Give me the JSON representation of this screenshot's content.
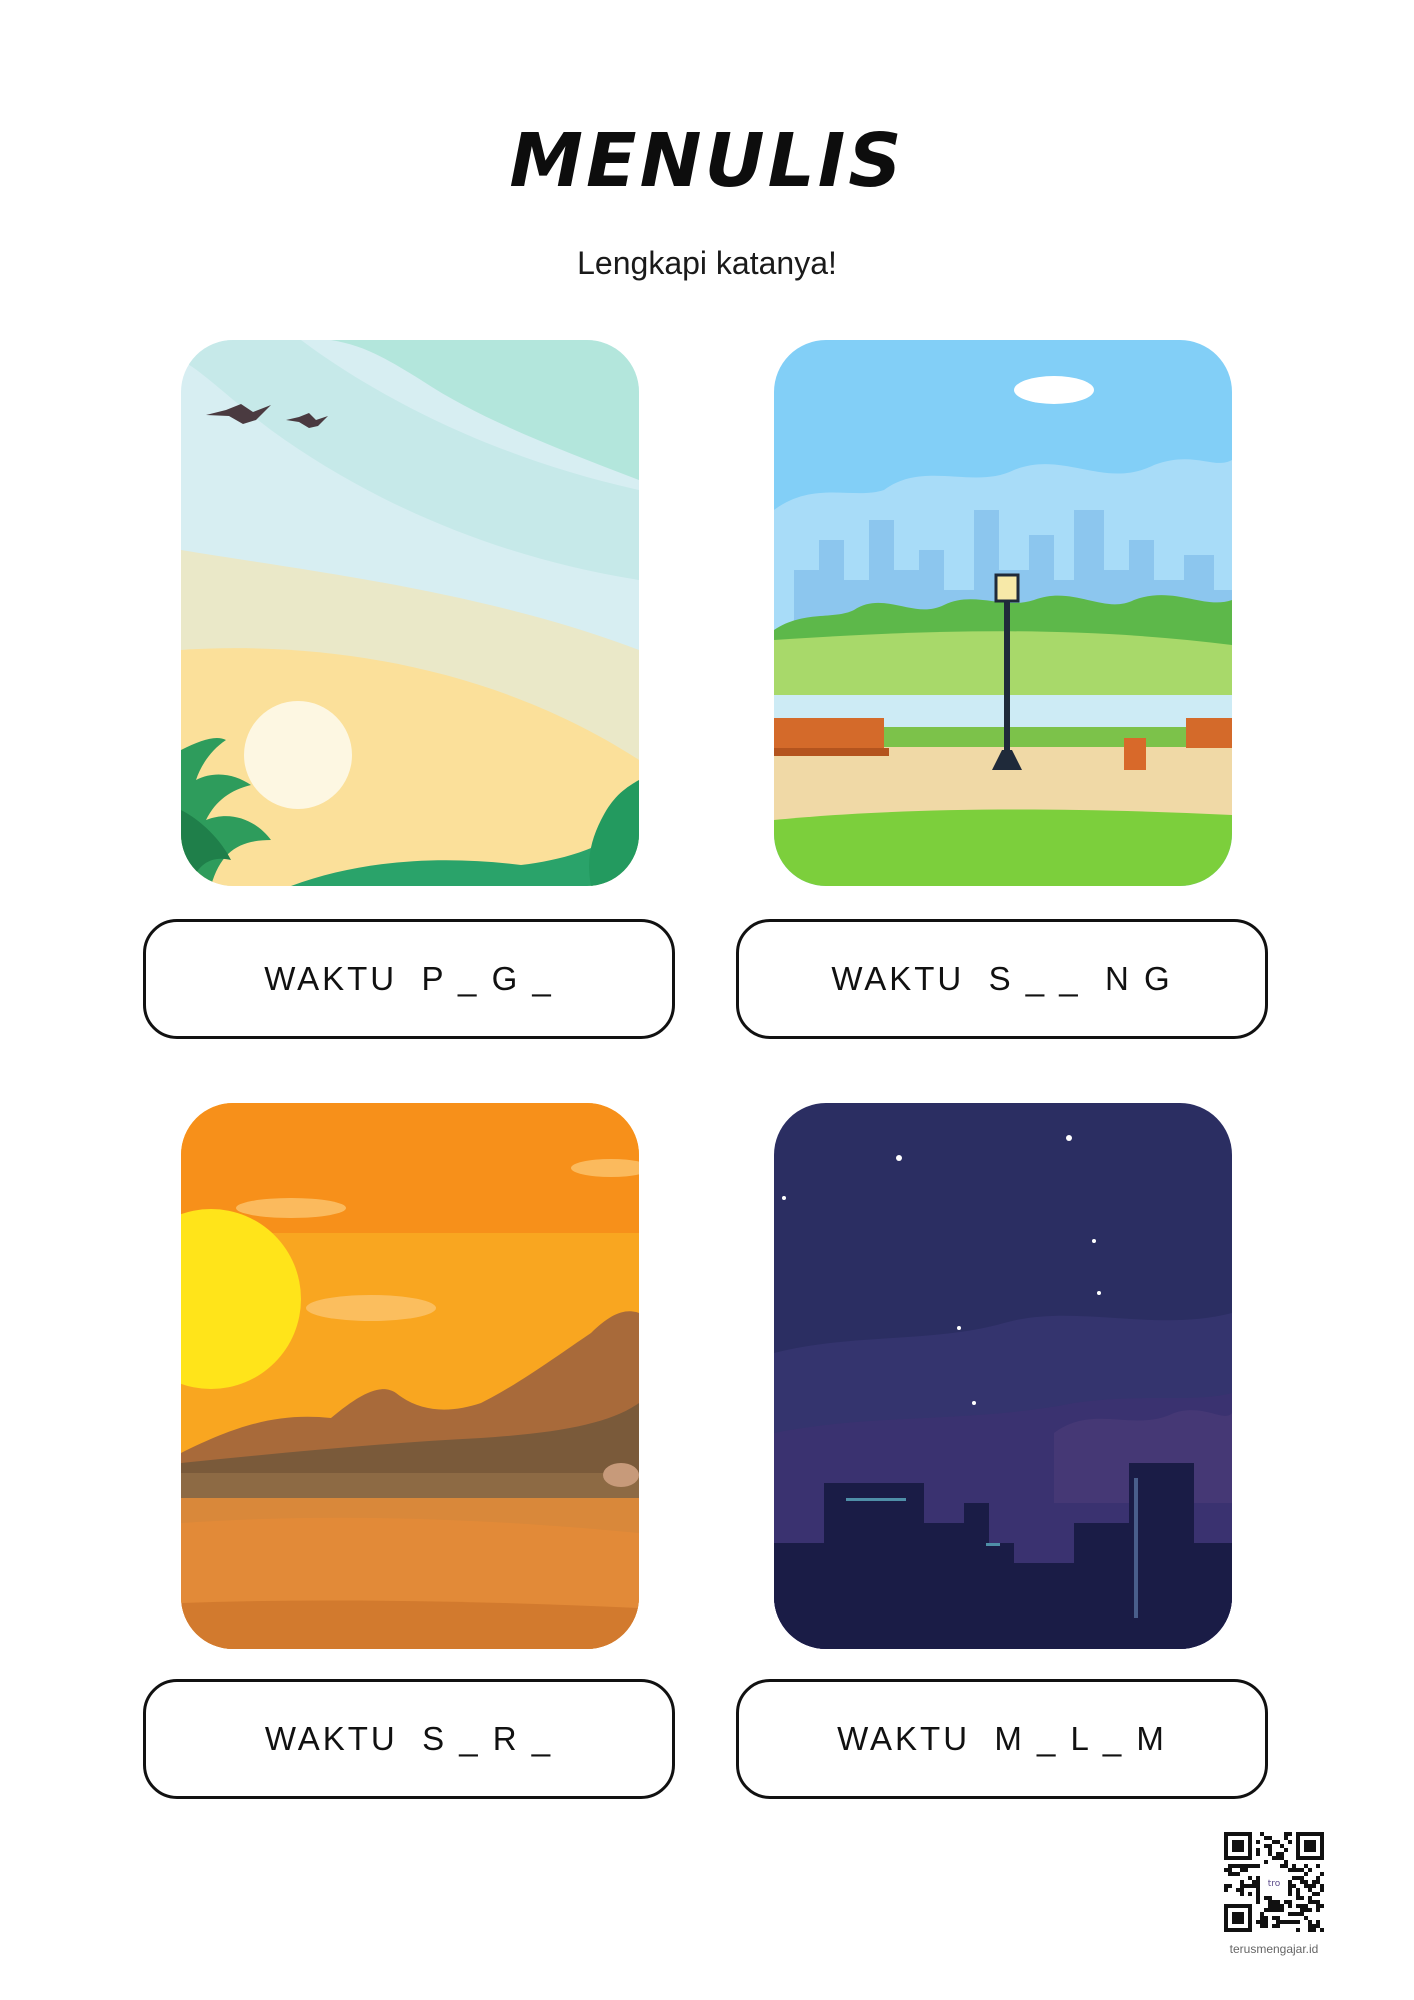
{
  "title": "MENULIS",
  "subtitle": "Lengkapi katanya!",
  "cards": [
    {
      "scene": "morning-sunrise-scene",
      "label": "WAKTU  P _ G _"
    },
    {
      "scene": "daytime-park-scene",
      "label": "WAKTU  S _ _  N G"
    },
    {
      "scene": "evening-sunset-scene",
      "label": "WAKTU  S _ R _"
    },
    {
      "scene": "night-city-scene",
      "label": "WAKTU  M _ L _ M"
    }
  ],
  "qr": {
    "center_mark": "tro"
  },
  "footer": {
    "site": "terusmengajar.id"
  }
}
